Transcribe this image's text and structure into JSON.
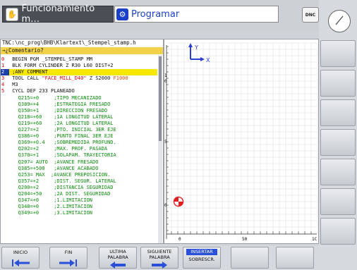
{
  "header": {
    "mode_tab": "Funcionamiento m…",
    "program_tab": "Programar",
    "dnc_label": "DNC"
  },
  "editor": {
    "path": "TNC:\\nc_prog\\BHB\\Klartext\\_Stempel_stamp.h",
    "comment_bar": "→¿Comentario?",
    "lines": [
      {
        "n": "0",
        "text": " BEGIN PGM _STEMPEL_STAMP MM"
      },
      {
        "n": "1",
        "text": " BLK FORM CYLINDER Z R30 L60 DIST+2"
      },
      {
        "n": "2",
        "text": " ;ANY COMMENT",
        "current": true
      },
      {
        "n": "3",
        "text": " TOOL CALL ",
        "s": "\"FACE_MILL_D40\"",
        "t": " Z S2000 ",
        "f": "F1000"
      },
      {
        "n": "4",
        "text": " M3"
      },
      {
        "n": "5",
        "text": " CYCL DEF 233 PLANEADO"
      },
      {
        "n": "",
        "text": "   Q215=+0     ;TIPO MECANIZADO"
      },
      {
        "n": "",
        "text": "   Q389=+4     ;ESTRATEGIA FRESADO"
      },
      {
        "n": "",
        "text": "   Q350=+1     ;DIRECCION FRESADO"
      },
      {
        "n": "",
        "text": "   Q218=+60    ;1A LONGITUD LATERAL"
      },
      {
        "n": "",
        "text": "   Q219=+60    ;2A LONGITUD LATERAL"
      },
      {
        "n": "",
        "text": "   Q227=+2     ;PTO. INICIAL 3ER EJE"
      },
      {
        "n": "",
        "text": "   Q386=+0     ;PUNTO FINAL 3ER EJE"
      },
      {
        "n": "",
        "text": "   Q369=+0.4   ;SOBREMEDIDA PROFUND."
      },
      {
        "n": "",
        "text": "   Q202=+2     ;MAX. PROF. PASADA"
      },
      {
        "n": "",
        "text": "   Q370=+1     ;SOLAPAM. TRAYECTORIA"
      },
      {
        "n": "",
        "text": "   Q207= AUTO  ;AVANCE FRESADO"
      },
      {
        "n": "",
        "text": "   Q385=+500   ;AVANCE ACABADO"
      },
      {
        "n": "",
        "text": "   Q253= MAX  ;AVANCE PREPOSICION."
      },
      {
        "n": "",
        "text": "   Q357=+2     ;DIST. SEGUR. LATERAL"
      },
      {
        "n": "",
        "text": "   Q200=+2     ;DISTANCIA SEGURIDAD"
      },
      {
        "n": "",
        "text": "   Q204=+50    ;2A DIST. SEGURIDAD"
      },
      {
        "n": "",
        "text": "   Q347=+0     ;1.LIMITACION"
      },
      {
        "n": "",
        "text": "   Q348=+0     ;2.LIMITACION"
      },
      {
        "n": "",
        "text": "   Q349=+0     ;3.LIMITACION"
      }
    ]
  },
  "graphic": {
    "axis_x": "X",
    "axis_y": "Y",
    "ruler_v": [
      "1",
      "0",
      "5",
      "0"
    ],
    "ruler_h": [
      "0",
      "50",
      "1C"
    ],
    "colors": {
      "axis_x": "#2a3fd0",
      "axis_y": "#2a3fd0",
      "marker": "#e02020"
    }
  },
  "softkeys": {
    "inicio": "INICIO",
    "fin": "FIN",
    "ultima": "ULTIMA PALABRA",
    "siguiente": "SIGUIENTE PALABRA",
    "insertar": "INSERTAR",
    "sobrescr": "SOBRESCR."
  }
}
